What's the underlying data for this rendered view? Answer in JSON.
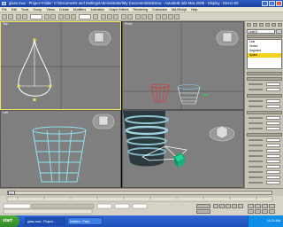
{
  "window": {
    "title": "glass.max - Project Folder: C:\\Documents and Settings\\Administrator\\My Documents\\3dsmax - Autodesk 3ds Max 2009 - Display : Direct 3D"
  },
  "menu": [
    "File",
    "Edit",
    "Tools",
    "Group",
    "Views",
    "Create",
    "Modifiers",
    "Animation",
    "Graph Editors",
    "Rendering",
    "Customize",
    "MAXScript",
    "Help"
  ],
  "viewports": {
    "top_left": "Top",
    "top_right": "Front",
    "bottom_left": "Left",
    "bottom_right": "Perspective"
  },
  "command_panel": {
    "object_name": "Line01",
    "modifier_stack": [
      "Line",
      "Vertex",
      "Segment",
      "Spline"
    ]
  },
  "timeline": {
    "frame": "0 / 100"
  },
  "taskbar": {
    "start_label": "start",
    "tasks": [
      "glass.max - Project...",
      "Untitled - Paint"
    ],
    "clock": "10:24 AM"
  },
  "colors": {
    "active_viewport_border": "#f0e060",
    "viewport_bg": "#7f7f7f",
    "selected_modifier": "#f5d21a"
  }
}
